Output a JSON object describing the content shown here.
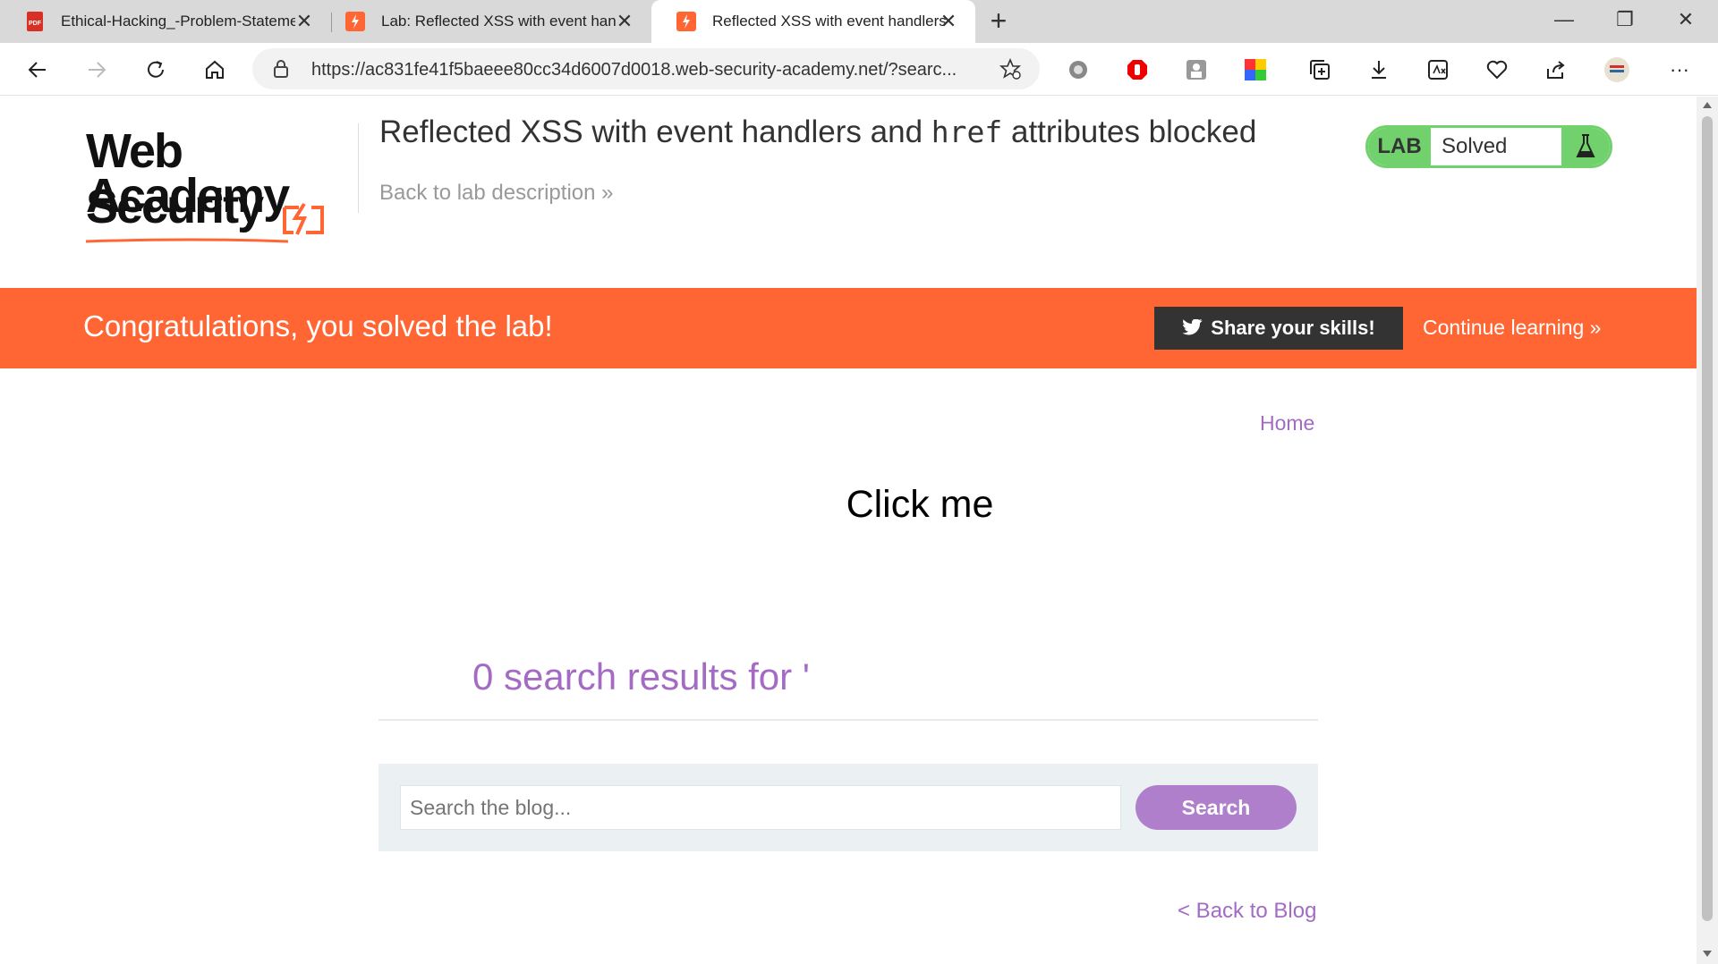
{
  "browser": {
    "tabs": [
      {
        "title": "Ethical-Hacking_-Problem-Statement",
        "icon": "pdf-icon"
      },
      {
        "title": "Lab: Reflected XSS with event handlers",
        "icon": "portswigger-icon"
      },
      {
        "title": "Reflected XSS with event handlers",
        "icon": "portswigger-icon"
      }
    ],
    "url": "https://ac831fe41f5baeee80cc34d6007d0018.web-security-academy.net/?searc..."
  },
  "header": {
    "logo_line1": "Web Security",
    "logo_line2": "Academy",
    "title_part1": "Reflected XSS with event handlers and ",
    "title_code": "href",
    "title_part2": " attributes blocked",
    "back_link": "Back to lab description »",
    "badge_label": "LAB",
    "badge_status": "Solved"
  },
  "banner": {
    "message": "Congratulations, you solved the lab!",
    "share_label": "Share your skills!",
    "continue_label": "Continue learning »"
  },
  "main": {
    "home_link": "Home",
    "click_me": "Click me",
    "results_text": "0 search results for '",
    "search_placeholder": "Search the blog...",
    "search_button": "Search",
    "back_to_blog": "< Back to Blog"
  },
  "colors": {
    "accent_orange": "#ff6633",
    "accent_purple": "#a36bc4",
    "lab_green": "#70d16d"
  }
}
